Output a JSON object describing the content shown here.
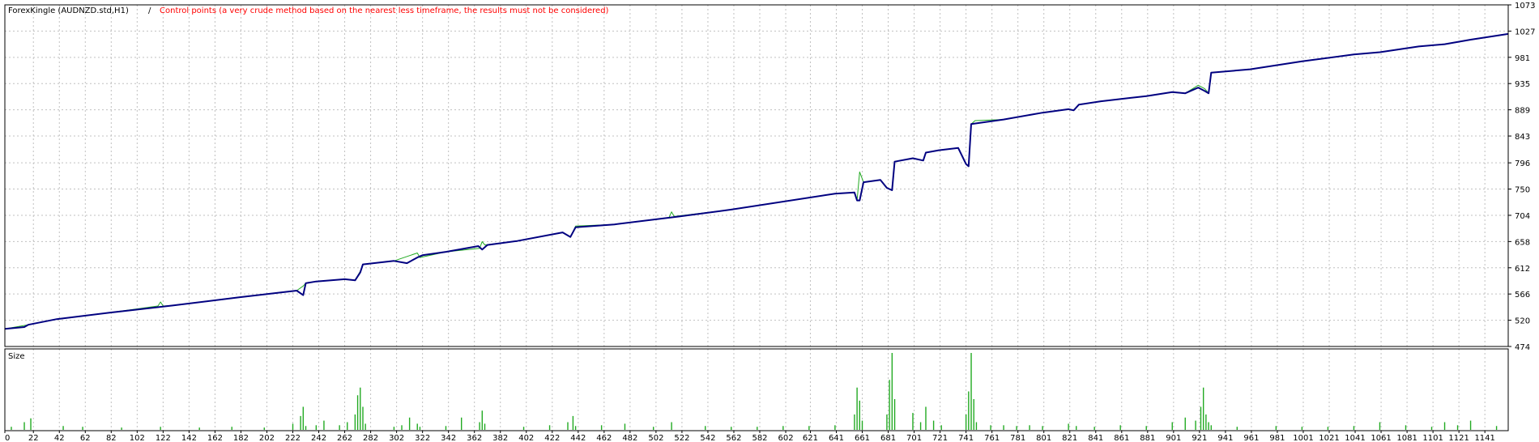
{
  "header": {
    "symbol_label": "ForexKingle (AUDNZD.std,H1)",
    "separator": " / ",
    "note": "Control points (a very crude method based on the nearest less timeframe, the results must not be considered)"
  },
  "colors": {
    "balance_line": "#000080",
    "equity_line": "#22aa22",
    "size_bars": "#22aa22",
    "note_text": "#ff0000",
    "grid": "#c0c0c0",
    "axis_text": "#000000"
  },
  "chart_data": [
    {
      "type": "line",
      "title": "",
      "ylim": [
        474,
        1073
      ],
      "y_ticks": [
        474,
        520,
        566,
        612,
        658,
        704,
        750,
        796,
        843,
        889,
        935,
        981,
        1027,
        1073
      ],
      "xlim": [
        0,
        1159
      ],
      "grid": true,
      "series": [
        {
          "role": "balance",
          "x": [
            0,
            15,
            18,
            40,
            80,
            130,
            180,
            225,
            230,
            232,
            240,
            262,
            270,
            274,
            276,
            300,
            310,
            318,
            322,
            340,
            365,
            368,
            372,
            395,
            430,
            436,
            440,
            470,
            520,
            560,
            640,
            655,
            657,
            659,
            662,
            675,
            680,
            684,
            686,
            700,
            708,
            710,
            720,
            735,
            741,
            743,
            745,
            770,
            800,
            820,
            824,
            828,
            845,
            880,
            900,
            910,
            920,
            925,
            928,
            930,
            960,
            1000,
            1040,
            1060,
            1090,
            1110,
            1130,
            1159
          ],
          "y": [
            505,
            508,
            512,
            522,
            533,
            546,
            560,
            572,
            564,
            585,
            588,
            592,
            590,
            604,
            618,
            624,
            620,
            630,
            634,
            640,
            650,
            644,
            652,
            659,
            674,
            666,
            683,
            688,
            702,
            714,
            742,
            744,
            730,
            730,
            762,
            766,
            752,
            748,
            798,
            804,
            800,
            814,
            818,
            822,
            794,
            790,
            864,
            872,
            884,
            890,
            888,
            898,
            904,
            913,
            920,
            918,
            928,
            922,
            918,
            954,
            960,
            974,
            986,
            990,
            1000,
            1004,
            1012,
            1022
          ]
        },
        {
          "role": "equity",
          "x": [
            0,
            18,
            40,
            80,
            118,
            120,
            122,
            130,
            180,
            225,
            230,
            232,
            240,
            262,
            270,
            274,
            276,
            300,
            318,
            320,
            340,
            366,
            368,
            370,
            395,
            430,
            436,
            440,
            470,
            512,
            514,
            516,
            560,
            640,
            655,
            657,
            659,
            662,
            675,
            680,
            684,
            686,
            700,
            708,
            710,
            720,
            735,
            741,
            743,
            745,
            748,
            770,
            800,
            820,
            824,
            828,
            845,
            880,
            900,
            910,
            920,
            925,
            928,
            930,
            960,
            1000,
            1040,
            1060,
            1090,
            1110,
            1130,
            1159
          ],
          "y": [
            505,
            512,
            522,
            533,
            545,
            552,
            545,
            546,
            560,
            572,
            580,
            585,
            588,
            592,
            590,
            606,
            618,
            624,
            638,
            630,
            640,
            646,
            658,
            652,
            659,
            674,
            666,
            685,
            688,
            700,
            710,
            702,
            714,
            742,
            744,
            730,
            780,
            762,
            766,
            752,
            748,
            798,
            804,
            800,
            814,
            818,
            822,
            794,
            790,
            864,
            870,
            872,
            884,
            890,
            888,
            898,
            904,
            913,
            920,
            918,
            932,
            926,
            918,
            954,
            960,
            974,
            986,
            990,
            1000,
            1004,
            1012,
            1022
          ]
        }
      ]
    },
    {
      "type": "bar",
      "title": "Size",
      "xlim": [
        0,
        1159
      ],
      "ylim": [
        0,
        1
      ],
      "x_ticks": [
        "0",
        "22",
        "42",
        "62",
        "82",
        "102",
        "122",
        "142",
        "162",
        "182",
        "202",
        "222",
        "242",
        "262",
        "282",
        "302",
        "322",
        "342",
        "362",
        "382",
        "402",
        "422",
        "442",
        "462",
        "482",
        "502",
        "522",
        "542",
        "562",
        "582",
        "602",
        "621",
        "641",
        "661",
        "681",
        "701",
        "721",
        "741",
        "761",
        "781",
        "801",
        "821",
        "841",
        "861",
        "881",
        "901",
        "921",
        "941",
        "961",
        "981",
        "1001",
        "1021",
        "1041",
        "1061",
        "1081",
        "1101",
        "1121",
        "1141"
      ],
      "bars": {
        "x": [
          5,
          15,
          20,
          45,
          60,
          90,
          120,
          150,
          175,
          200,
          222,
          228,
          230,
          232,
          240,
          246,
          258,
          264,
          270,
          272,
          274,
          276,
          278,
          300,
          306,
          312,
          318,
          320,
          340,
          352,
          366,
          368,
          370,
          400,
          420,
          434,
          438,
          440,
          460,
          478,
          500,
          514,
          540,
          560,
          580,
          600,
          620,
          640,
          655,
          657,
          659,
          661,
          680,
          682,
          684,
          686,
          700,
          706,
          710,
          716,
          722,
          741,
          743,
          745,
          747,
          749,
          760,
          770,
          780,
          790,
          800,
          820,
          826,
          840,
          860,
          880,
          900,
          910,
          918,
          922,
          924,
          926,
          928,
          930,
          950,
          980,
          1000,
          1020,
          1040,
          1060,
          1080,
          1100,
          1110,
          1120,
          1130,
          1150
        ],
        "values": [
          0.04,
          0.1,
          0.15,
          0.05,
          0.04,
          0.03,
          0.04,
          0.03,
          0.04,
          0.03,
          0.08,
          0.18,
          0.3,
          0.05,
          0.06,
          0.12,
          0.06,
          0.1,
          0.2,
          0.45,
          0.55,
          0.3,
          0.08,
          0.04,
          0.06,
          0.16,
          0.08,
          0.04,
          0.05,
          0.16,
          0.1,
          0.25,
          0.08,
          0.04,
          0.06,
          0.1,
          0.18,
          0.05,
          0.06,
          0.08,
          0.04,
          0.1,
          0.05,
          0.04,
          0.04,
          0.05,
          0.05,
          0.06,
          0.2,
          0.55,
          0.38,
          0.12,
          0.2,
          0.65,
          1.0,
          0.4,
          0.22,
          0.1,
          0.3,
          0.12,
          0.06,
          0.2,
          0.5,
          1.0,
          0.4,
          0.1,
          0.06,
          0.06,
          0.05,
          0.06,
          0.05,
          0.08,
          0.05,
          0.04,
          0.06,
          0.05,
          0.1,
          0.16,
          0.12,
          0.3,
          0.55,
          0.2,
          0.1,
          0.06,
          0.04,
          0.05,
          0.04,
          0.04,
          0.05,
          0.1,
          0.06,
          0.04,
          0.1,
          0.06,
          0.12,
          0.05
        ]
      }
    }
  ]
}
